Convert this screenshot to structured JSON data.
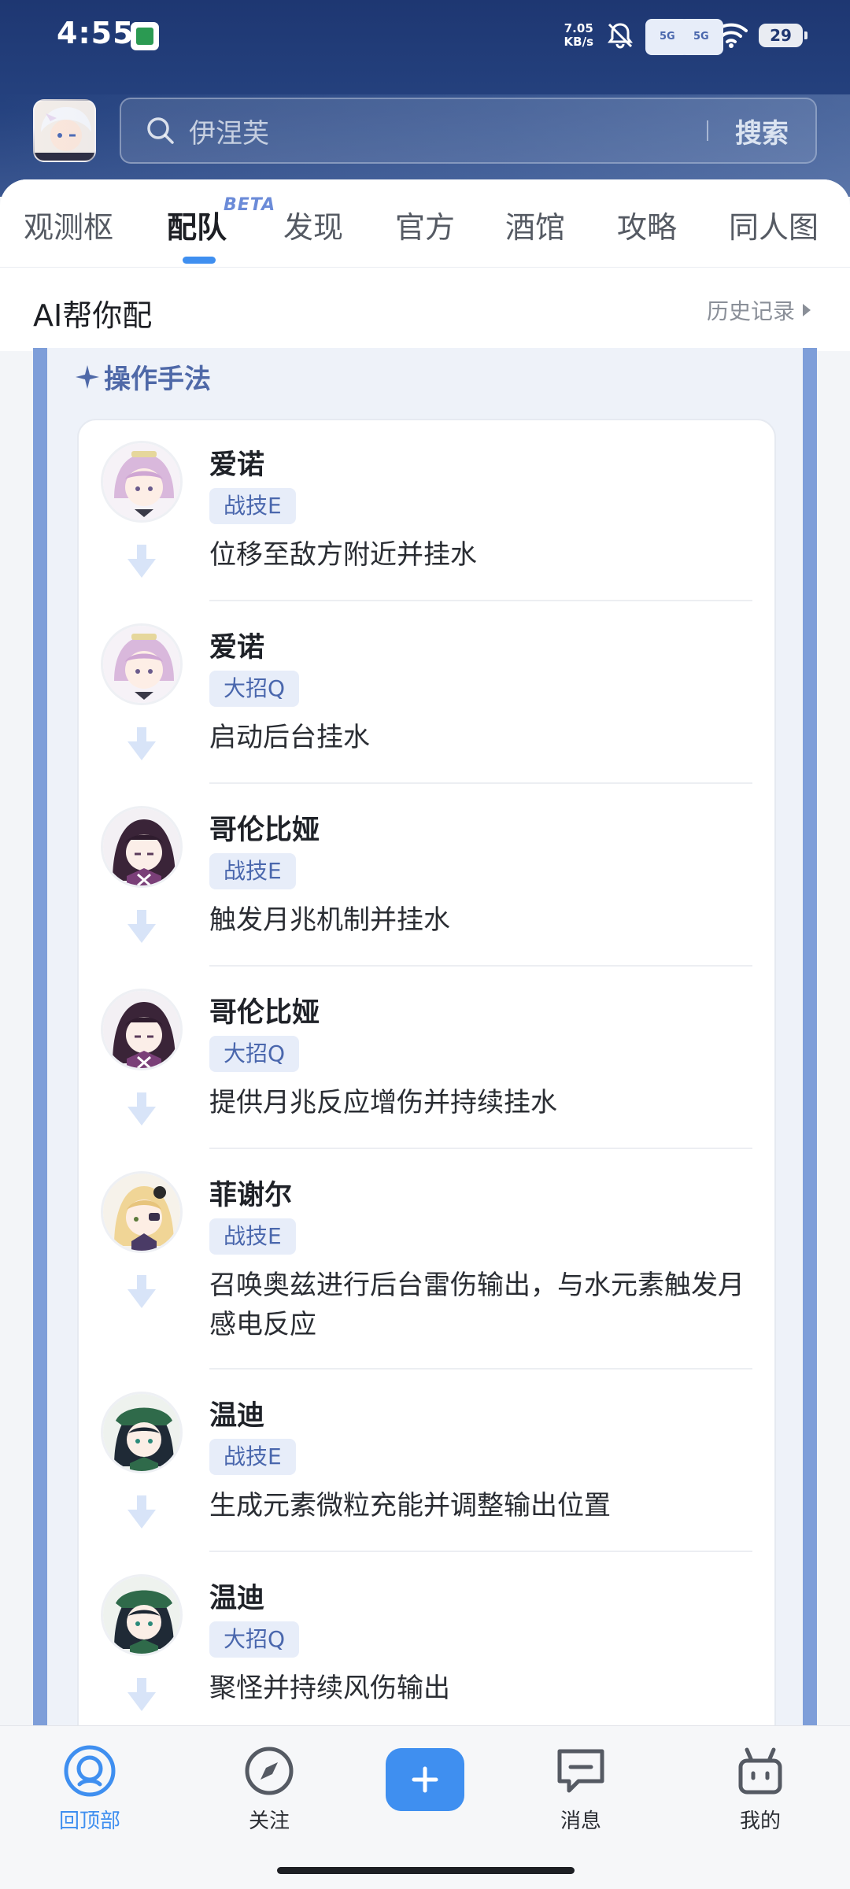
{
  "status_bar": {
    "time": "4:55",
    "net_speed_value": "7.05",
    "net_speed_unit": "KB/s",
    "signal1_label": "5G",
    "signal2_label": "5G",
    "battery": "29"
  },
  "header": {
    "search_placeholder": "伊涅芙",
    "search_button": "搜索"
  },
  "tabs": [
    {
      "label": "观测枢"
    },
    {
      "label": "配队",
      "badge": "BETA"
    },
    {
      "label": "发现"
    },
    {
      "label": "官方"
    },
    {
      "label": "酒馆"
    },
    {
      "label": "攻略"
    },
    {
      "label": "同人图"
    }
  ],
  "ai_section": {
    "title": "AI帮你配",
    "history_label": "历史记录"
  },
  "operation": {
    "title": "操作手法",
    "steps": [
      {
        "name": "爱诺",
        "skill": "战技E",
        "desc": "位移至敌方附近并挂水"
      },
      {
        "name": "爱诺",
        "skill": "大招Q",
        "desc": "启动后台挂水"
      },
      {
        "name": "哥伦比娅",
        "skill": "战技E",
        "desc": "触发月兆机制并挂水"
      },
      {
        "name": "哥伦比娅",
        "skill": "大招Q",
        "desc": "提供月兆反应增伤并持续挂水"
      },
      {
        "name": "菲谢尔",
        "skill": "战技E",
        "desc": "召唤奥兹进行后台雷伤输出，与水元素触发月感电反应"
      },
      {
        "name": "温迪",
        "skill": "战技E",
        "desc": "生成元素微粒充能并调整输出位置"
      },
      {
        "name": "温迪",
        "skill": "大招Q",
        "desc": "聚怪并持续风伤输出"
      }
    ]
  },
  "bottom_nav": {
    "home": "回顶部",
    "follow": "关注",
    "messages": "消息",
    "mine": "我的"
  },
  "colors": {
    "accent": "#3f8ff0",
    "header_bg": "#1e3772",
    "tag_bg": "#e7edf9",
    "tag_text": "#4a67ad",
    "card_border": "#7e9ed9"
  }
}
